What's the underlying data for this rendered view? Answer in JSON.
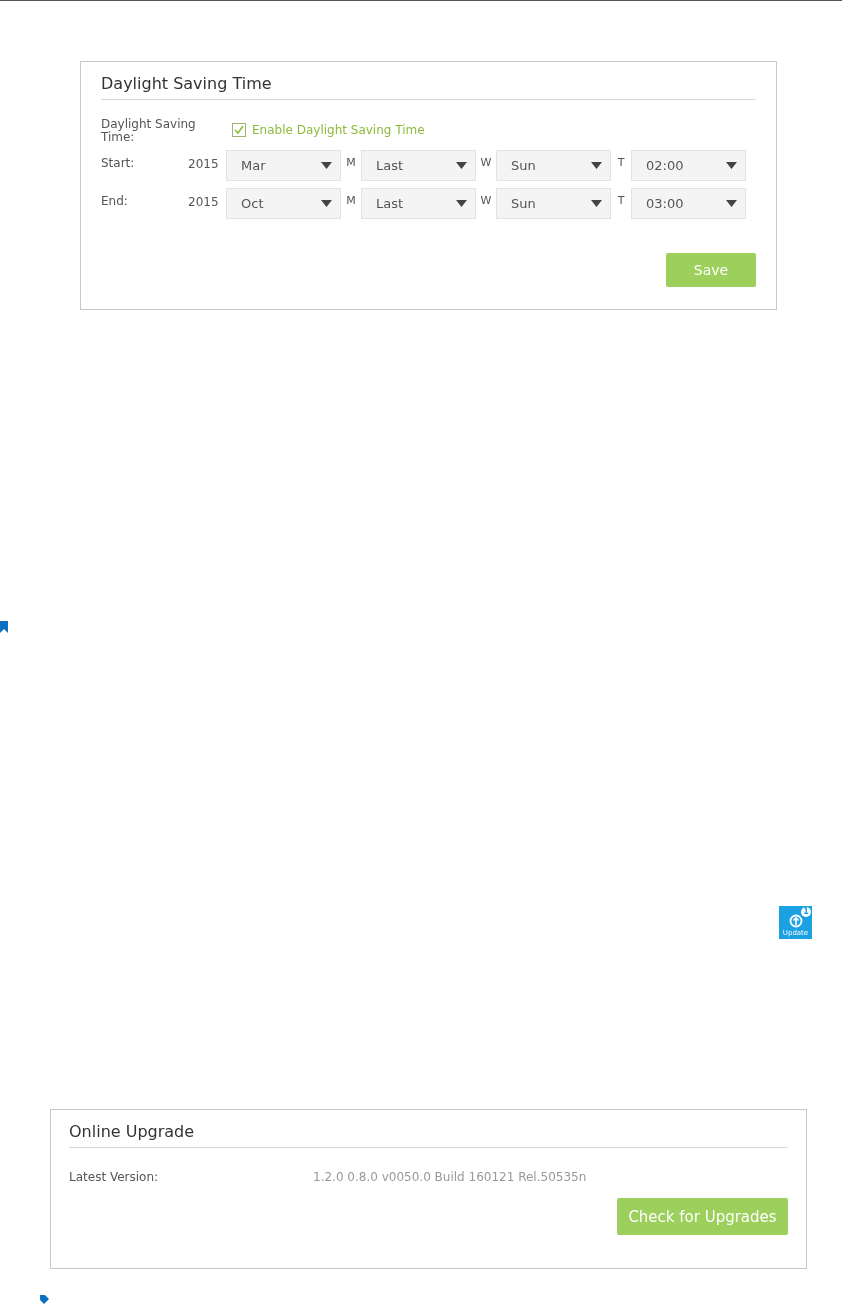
{
  "dst_panel": {
    "title": "Daylight Saving Time",
    "field_label": "Daylight Saving Time:",
    "enable": {
      "label": "Enable Daylight Saving Time",
      "checked": true
    },
    "rows": [
      {
        "label": "Start:",
        "year": "2015",
        "selects": [
          {
            "value": "Mar",
            "unit": "M"
          },
          {
            "value": "Last",
            "unit": "W"
          },
          {
            "value": "Sun",
            "unit": "T"
          },
          {
            "value": "02:00"
          }
        ]
      },
      {
        "label": "End:",
        "year": "2015",
        "selects": [
          {
            "value": "Oct",
            "unit": "M"
          },
          {
            "value": "Last",
            "unit": "W"
          },
          {
            "value": "Sun",
            "unit": "T"
          },
          {
            "value": "03:00"
          }
        ]
      }
    ],
    "button": "Save"
  },
  "update_icon": {
    "label": "Update",
    "count": "1"
  },
  "upgrade_panel": {
    "title": "Online Upgrade",
    "label": "Latest Version:",
    "value": "1.2.0 0.8.0 v0050.0 Build 160121 Rel.50535n",
    "button": "Check for Upgrades"
  }
}
